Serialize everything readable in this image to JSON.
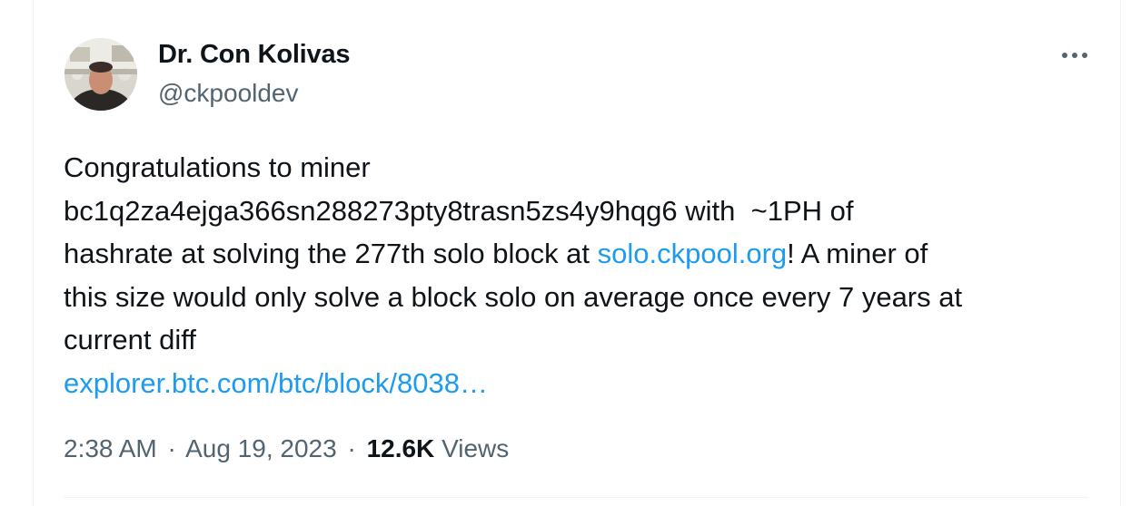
{
  "tweet": {
    "author": {
      "display_name": "Dr. Con Kolivas",
      "handle": "@ckpooldev"
    },
    "more_icon": "more-horizontal-icon",
    "body_lines": [
      [
        {
          "t": "Congratulations to miner"
        }
      ],
      [
        {
          "t": "bc1q2za4ejga366sn288273pty8trasn5zs4y9hqg6 with  ~1PH of"
        }
      ],
      [
        {
          "t": "hashrate at solving the 277th solo block at "
        },
        {
          "t": "solo.ckpool.org",
          "link": true
        },
        {
          "t": "! A miner of"
        }
      ],
      [
        {
          "t": "this size would only solve a block solo on average once every 7 years at"
        }
      ],
      [
        {
          "t": "current diff"
        }
      ],
      [
        {
          "t": "explorer.btc.com/btc/block/8038…",
          "link": true
        }
      ]
    ],
    "meta": {
      "time": "2:38 AM",
      "separator": "·",
      "date": "Aug 19, 2023",
      "views_count": "12.6K",
      "views_label": "Views"
    },
    "colors": {
      "text": "#0f1419",
      "secondary": "#536471",
      "link": "#1d9bf0",
      "border": "#eff3f4"
    }
  }
}
